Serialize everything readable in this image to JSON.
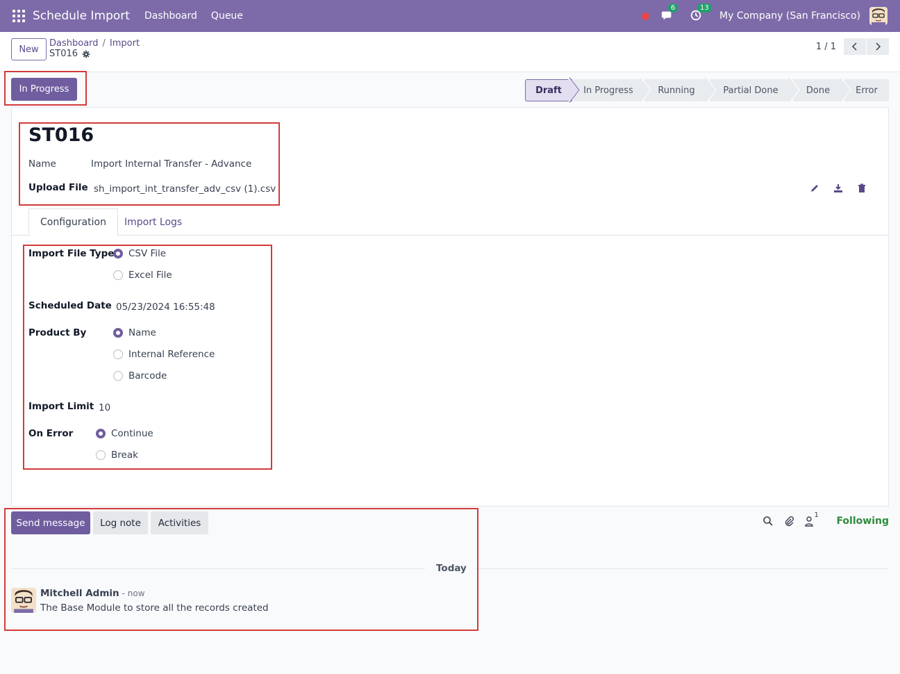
{
  "navbar": {
    "app_title": "Schedule Import",
    "menu": [
      "Dashboard",
      "Queue"
    ],
    "messages_badge": "6",
    "activities_badge": "13",
    "company": "My Company (San Francisco)"
  },
  "control": {
    "new_label": "New",
    "breadcrumb": [
      "Dashboard",
      "Import"
    ],
    "breadcrumb_sep": "/",
    "record_name": "ST016",
    "pager": "1 / 1"
  },
  "status": {
    "action_button": "In Progress",
    "stages": [
      "Draft",
      "In Progress",
      "Running",
      "Partial Done",
      "Done",
      "Error"
    ],
    "active_stage": "Draft"
  },
  "record": {
    "title": "ST016",
    "name_label": "Name",
    "name_value": "Import Internal Transfer - Advance",
    "upload_label": "Upload File",
    "upload_value": "sh_import_int_transfer_adv_csv (1).csv"
  },
  "tabs": [
    "Configuration",
    "Import Logs"
  ],
  "config": {
    "file_type_label": "Import File Type",
    "file_type_options": [
      "CSV File",
      "Excel File"
    ],
    "file_type_selected": "CSV File",
    "scheduled_date_label": "Scheduled Date",
    "scheduled_date_value": "05/23/2024 16:55:48",
    "product_by_label": "Product By",
    "product_by_options": [
      "Name",
      "Internal Reference",
      "Barcode"
    ],
    "product_by_selected": "Name",
    "import_limit_label": "Import Limit",
    "import_limit_value": "10",
    "on_error_label": "On Error",
    "on_error_options": [
      "Continue",
      "Break"
    ],
    "on_error_selected": "Continue"
  },
  "chatter": {
    "send_message": "Send message",
    "log_note": "Log note",
    "activities": "Activities",
    "followers_count": "1",
    "following": "Following",
    "date_separator": "Today",
    "message": {
      "author": "Mitchell Admin",
      "time": "- now",
      "body": "The Base Module to store all the records created"
    }
  },
  "colors": {
    "brand": "#7c6ba8",
    "primary_button": "#6f5d9f",
    "following": "#2f8a3d",
    "annotation": "#d33a3a"
  }
}
